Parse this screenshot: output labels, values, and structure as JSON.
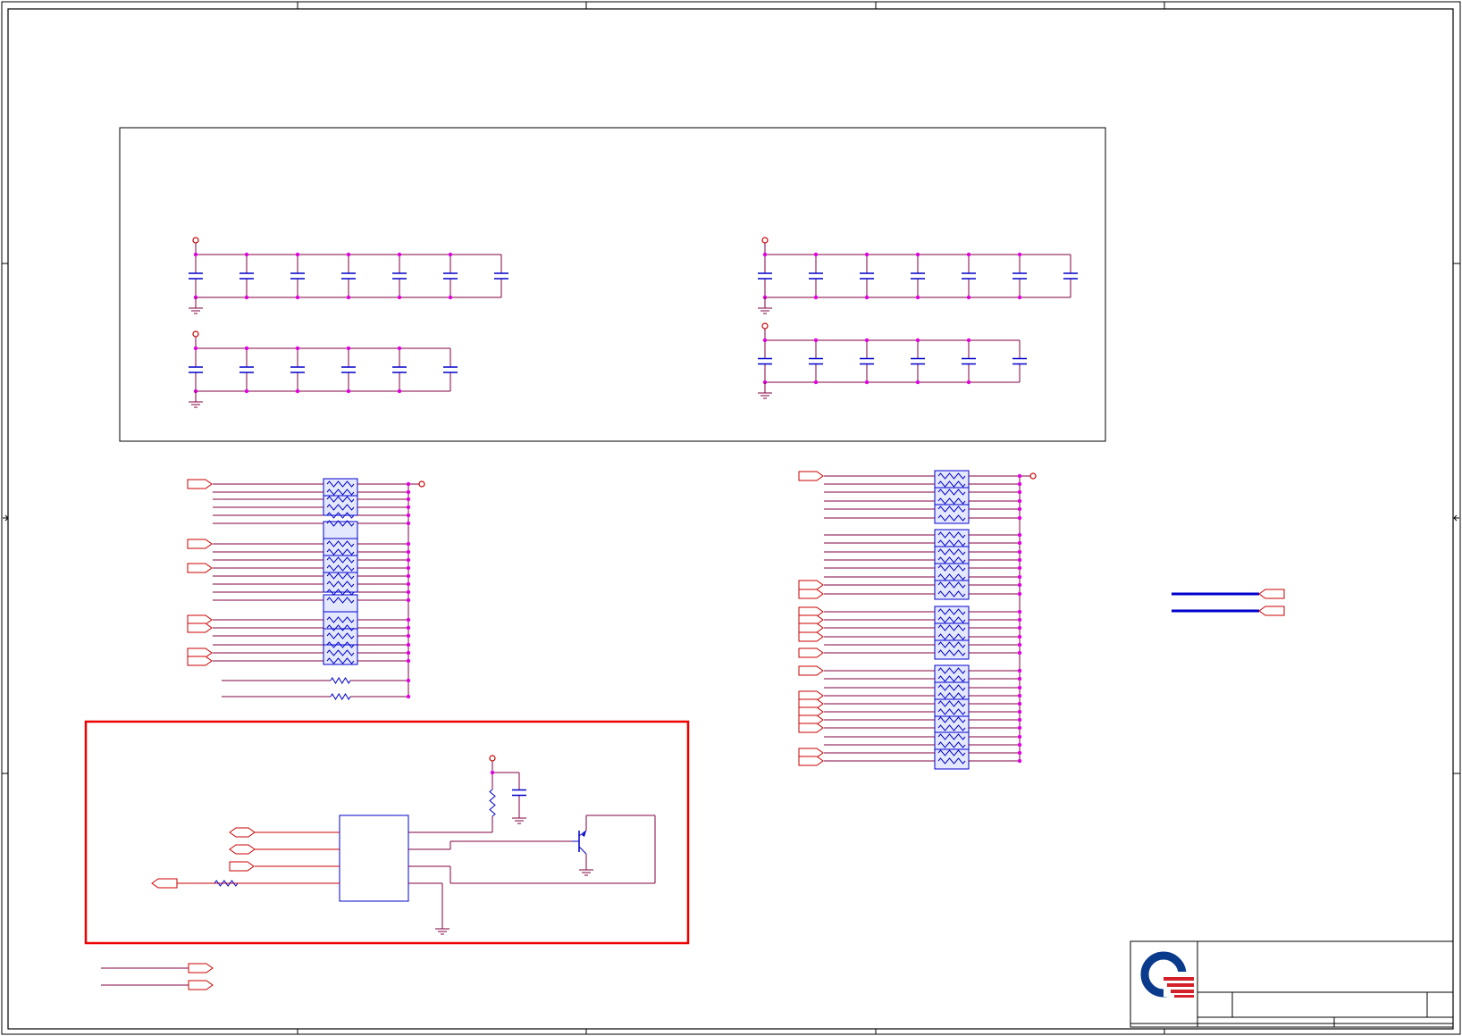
{
  "sheet": {
    "description_hidden": "",
    "colors": {
      "frame": "#000000",
      "wire": "#800040",
      "wire_red": "#cc0000",
      "component": "#0000cc",
      "junction": "#e000e0",
      "power": "#cc0000",
      "highlight_box": "#ee0000",
      "resistor_pack_fill": "#e4e8ff",
      "logo_blue": "#0a3a8c",
      "logo_red": "#d4202a"
    },
    "icons": {
      "logo": "quanta-logo",
      "ground": "ground-symbol",
      "power": "power-pin-circle",
      "capacitor": "capacitor-symbol",
      "resistor": "resistor-symbol",
      "resistor_pack": "resistor-array-symbol",
      "transistor": "npn-transistor-symbol",
      "port": "off-page-port-connector"
    }
  }
}
